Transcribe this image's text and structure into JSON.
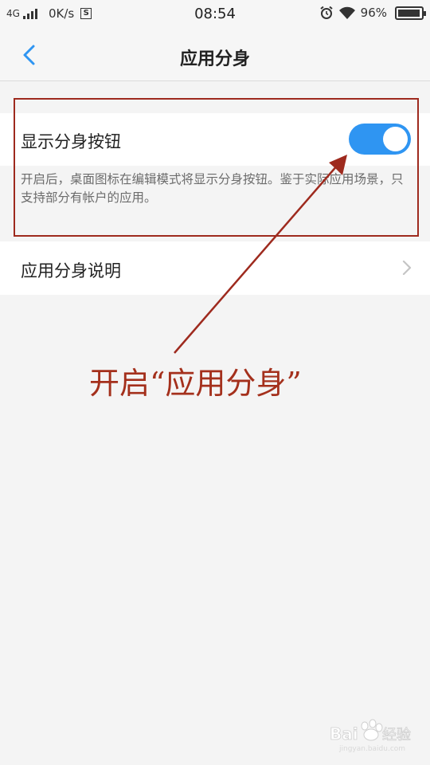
{
  "status_bar": {
    "network": "4G",
    "speed": "0K/s",
    "s_badge": "S",
    "time": "08:54",
    "battery_percent": "96%",
    "battery_level": 0.96,
    "icons": [
      "signal-icon",
      "s-badge-icon",
      "alarm-icon",
      "wifi-icon",
      "battery-icon"
    ]
  },
  "header": {
    "back_icon": "chevron-left-icon",
    "title": "应用分身"
  },
  "settings": {
    "toggle_label": "显示分身按钮",
    "toggle_on": true,
    "toggle_color": "#2f95f2",
    "description": "开启后，桌面图标在编辑模式将显示分身按钮。鉴于实际应用场景，只支持部分有帐户的应用。",
    "nav_label": "应用分身说明",
    "nav_icon": "chevron-right-icon"
  },
  "annotation": {
    "text": "开启“应用分身”",
    "color": "#a4301c"
  },
  "watermark": {
    "brand": "Baidu经验",
    "url": "jingyan.baidu.com"
  }
}
